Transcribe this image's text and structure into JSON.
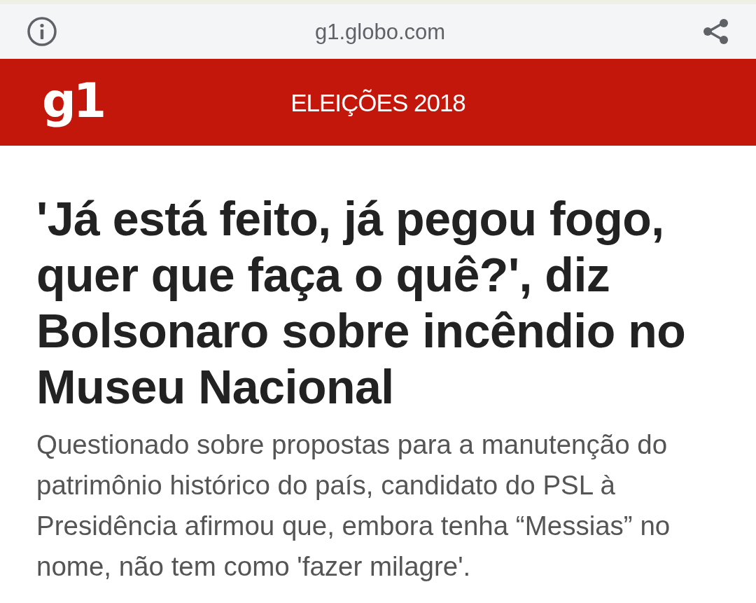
{
  "address_bar": {
    "url": "g1.globo.com"
  },
  "header": {
    "logo": "g1",
    "section": "ELEIÇÕES 2018"
  },
  "article": {
    "title": "'Já está feito, já pegou fogo, quer que faça o quê?', diz Bolsonaro sobre incêndio no Museu Nacional",
    "subtitle": "Questionado sobre propostas para a manutenção do patrimônio histórico do país, candidato do PSL à Presidência afirmou que, embora tenha “Messias” no nome, não tem como 'fazer milagre'."
  }
}
